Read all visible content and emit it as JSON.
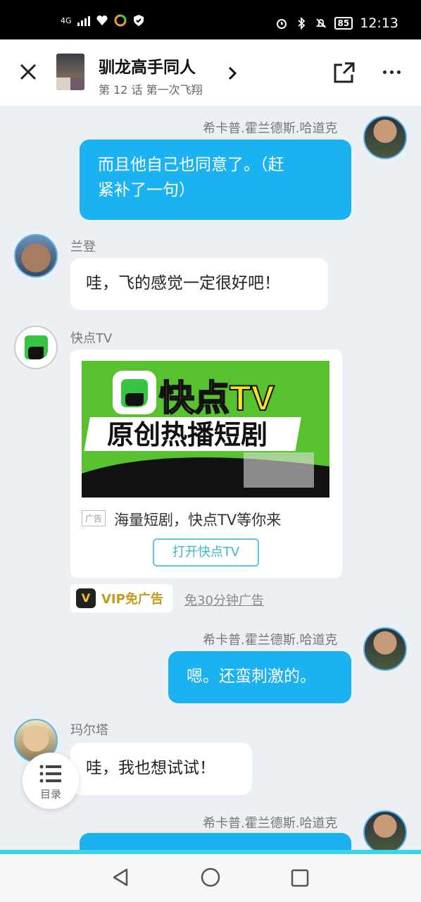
{
  "status_bar": {
    "network": "4G",
    "battery": "85",
    "time": "12:13"
  },
  "header": {
    "title": "驯龙高手同人",
    "subtitle": "第 12 话 第一次飞翔"
  },
  "messages": {
    "m1": {
      "sender": "希卡普.霍兰德斯.哈道克",
      "line1": "而且他自己也同意了。（赶",
      "line2": "紧补了一句）"
    },
    "m2": {
      "sender": "兰登",
      "text": "哇，飞的感觉一定很好吧！"
    },
    "m4": {
      "sender": "希卡普.霍兰德斯.哈道克",
      "text": "嗯。还蛮刺激的。"
    },
    "m5": {
      "sender": "玛尔塔",
      "text": "哇，我也想试试！"
    },
    "m6": {
      "sender": "希卡普.霍兰德斯.哈道克"
    }
  },
  "ad": {
    "sender": "快点TV",
    "image_title": "快点TV",
    "image_slogan": "原创热播短剧",
    "tag": "广告",
    "text": "海量短剧，快点TV等你来",
    "button": "打开快点TV"
  },
  "vip": {
    "badge": "V",
    "label": "VIP免广告",
    "skip": "免30分钟广告"
  },
  "toc": {
    "label": "目录"
  },
  "colors": {
    "my_bubble": "#1ab2f0",
    "accent": "#3fb6cf",
    "vip_gold": "#c49a1a"
  }
}
